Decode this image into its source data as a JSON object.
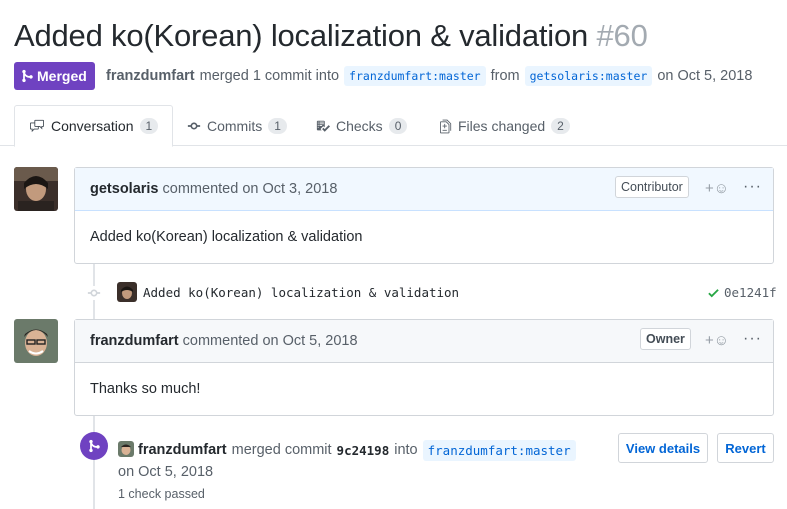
{
  "pr": {
    "title": "Added ko(Korean) localization & validation",
    "number": "#60"
  },
  "meta": {
    "state": "Merged",
    "author": "franzdumfart",
    "merged_text": "merged 1 commit into",
    "base_branch": "franzdumfart:master",
    "from_text": "from",
    "head_branch": "getsolaris:master",
    "date_text": "on Oct 5, 2018"
  },
  "tabs": [
    {
      "label": "Conversation",
      "count": "1"
    },
    {
      "label": "Commits",
      "count": "1"
    },
    {
      "label": "Checks",
      "count": "0"
    },
    {
      "label": "Files changed",
      "count": "2"
    }
  ],
  "comments": [
    {
      "author": "getsolaris",
      "action": "commented on Oct 3, 2018",
      "role": "Contributor",
      "body": "Added ko(Korean) localization & validation"
    },
    {
      "author": "franzdumfart",
      "action": "commented on Oct 5, 2018",
      "role": "Owner",
      "body": "Thanks so much!"
    }
  ],
  "commit": {
    "message": "Added ko(Korean) localization & validation",
    "sha": "0e1241f"
  },
  "merge_event": {
    "actor": "franzdumfart",
    "text": "merged commit",
    "sha": "9c24198",
    "into": "into",
    "branch": "franzdumfart:master",
    "date": "on Oct 5, 2018",
    "checks": "1 check passed",
    "view_details": "View details",
    "revert": "Revert"
  },
  "colors": {
    "merged": "#6f42c1",
    "link": "#0366d6",
    "success": "#28a745"
  }
}
